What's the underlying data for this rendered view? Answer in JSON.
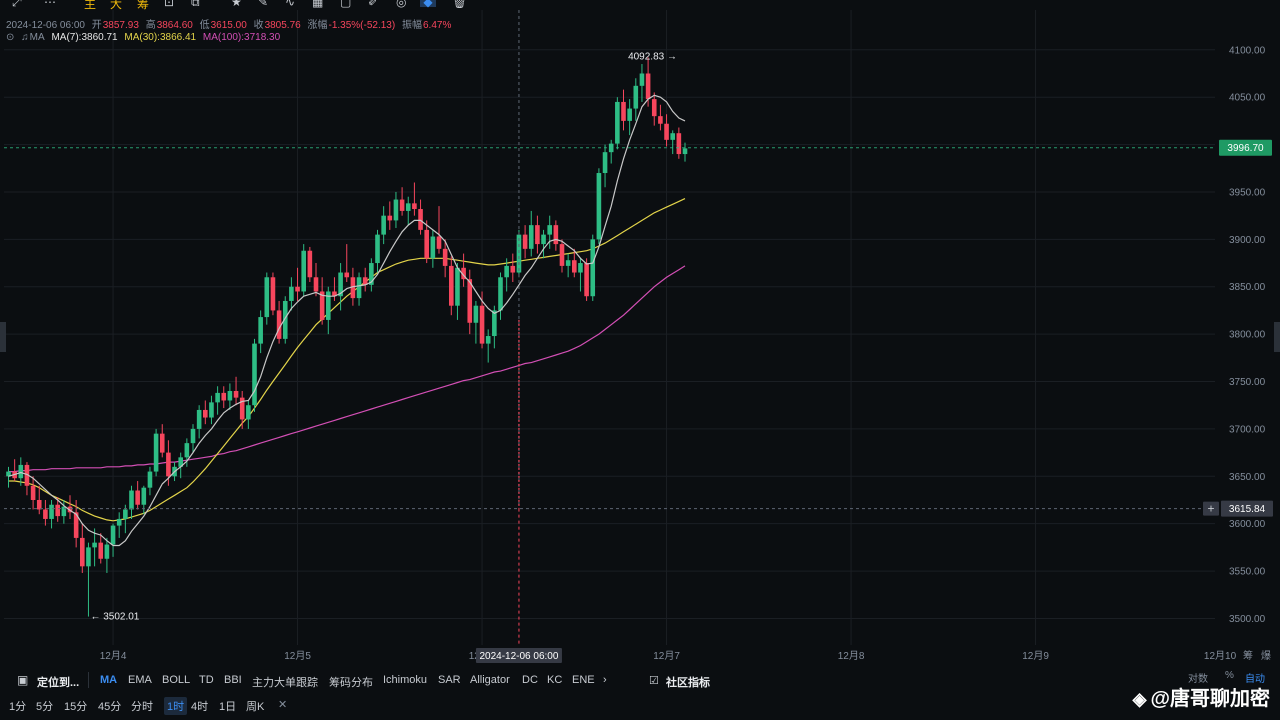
{
  "toolbar": {
    "items": [
      {
        "glyph": "⤢",
        "name": "expand-icon"
      },
      {
        "glyph": "⋯",
        "name": "more-icon"
      },
      {
        "glyph": "主",
        "name": "main-indicator-button"
      },
      {
        "glyph": "大",
        "name": "large-order-button"
      },
      {
        "glyph": "筹",
        "name": "chip-distribution-button"
      },
      {
        "glyph": "⊡",
        "name": "snapshot-icon"
      },
      {
        "glyph": "⧉",
        "name": "compare-icon"
      },
      {
        "glyph": "★",
        "name": "favorite-icon"
      },
      {
        "glyph": "✎",
        "name": "pencil-icon"
      },
      {
        "glyph": "∿",
        "name": "curve-icon"
      },
      {
        "glyph": "▦",
        "name": "candles-icon"
      },
      {
        "glyph": "▢",
        "name": "rectangle-icon"
      },
      {
        "glyph": "✐",
        "name": "annotate-icon"
      },
      {
        "glyph": "◎",
        "name": "magnet-icon"
      },
      {
        "glyph": "◆",
        "name": "select-tool-icon"
      },
      {
        "glyph": "🗑",
        "name": "trash-icon"
      }
    ]
  },
  "ohlc": {
    "date": "2024-12-06 06:00",
    "open_label": "开",
    "open": "3857.93",
    "high_label": "高",
    "high": "3864.60",
    "low_label": "低",
    "low": "3615.00",
    "close_label": "收",
    "close": "3805.76",
    "change_label": "涨幅",
    "change": "-1.35%(-52.13)",
    "amp_label": "振幅",
    "amp": "6.47%"
  },
  "ma_legend": {
    "label": "MA",
    "ma7": "MA(7):3860.71",
    "ma30": "MA(30):3866.41",
    "ma100": "MA(100):3718.30"
  },
  "colors": {
    "up": "#2ebd85",
    "down": "#f6465d",
    "ma7": "#c8c8c8",
    "ma30": "#e3d44a",
    "ma100": "#d34fb5",
    "grid": "#1b1f24",
    "price_tag": "#1f9a64"
  },
  "chart_data": {
    "type": "candlestick",
    "symbol_interval": "1时",
    "y_ticks": [
      "4100.00",
      "4050.00",
      "4000.00",
      "3950.00",
      "3900.00",
      "3850.00",
      "3800.00",
      "3750.00",
      "3700.00",
      "3650.00",
      "3600.00",
      "3550.00",
      "3500.00"
    ],
    "y_tick_values": [
      4100,
      4050,
      4000,
      3950,
      3900,
      3850,
      3800,
      3750,
      3700,
      3650,
      3600,
      3550,
      3500
    ],
    "ylim": [
      3472,
      4142
    ],
    "x_tick_labels": [
      "12月4",
      "12月5",
      "12月6",
      "12月7",
      "12月8",
      "12月9",
      "12月10"
    ],
    "x_tick_index": [
      17,
      47,
      77,
      107,
      137,
      167,
      197
    ],
    "current_price": "3996.70",
    "current_price_value": 3996.7,
    "crosshair_price": "3615.84",
    "crosshair_price_value": 3615.84,
    "crosshair_time": "2024-12-06 06:00",
    "crosshair_index": 83,
    "high_marker": "4092.83",
    "high_marker_index": 110,
    "high_marker_value": 4092.83,
    "low_marker": "3502.01",
    "low_marker_index": 13,
    "low_marker_value": 3502.01,
    "candles": [
      [
        3650,
        3660,
        3638,
        3655
      ],
      [
        3655,
        3668,
        3645,
        3648
      ],
      [
        3648,
        3670,
        3640,
        3662
      ],
      [
        3662,
        3665,
        3630,
        3640
      ],
      [
        3640,
        3650,
        3615,
        3625
      ],
      [
        3625,
        3640,
        3610,
        3615
      ],
      [
        3615,
        3625,
        3598,
        3605
      ],
      [
        3605,
        3625,
        3595,
        3620
      ],
      [
        3620,
        3628,
        3602,
        3608
      ],
      [
        3608,
        3625,
        3600,
        3618
      ],
      [
        3618,
        3630,
        3605,
        3612
      ],
      [
        3612,
        3625,
        3575,
        3585
      ],
      [
        3585,
        3600,
        3548,
        3555
      ],
      [
        3555,
        3580,
        3502,
        3575
      ],
      [
        3575,
        3595,
        3555,
        3580
      ],
      [
        3580,
        3590,
        3558,
        3563
      ],
      [
        3563,
        3585,
        3548,
        3578
      ],
      [
        3578,
        3600,
        3565,
        3598
      ],
      [
        3598,
        3612,
        3585,
        3605
      ],
      [
        3605,
        3620,
        3590,
        3615
      ],
      [
        3615,
        3640,
        3605,
        3635
      ],
      [
        3635,
        3645,
        3615,
        3620
      ],
      [
        3620,
        3640,
        3610,
        3638
      ],
      [
        3638,
        3660,
        3630,
        3655
      ],
      [
        3655,
        3700,
        3650,
        3695
      ],
      [
        3695,
        3705,
        3670,
        3675
      ],
      [
        3675,
        3688,
        3640,
        3650
      ],
      [
        3650,
        3665,
        3645,
        3660
      ],
      [
        3660,
        3675,
        3648,
        3670
      ],
      [
        3670,
        3690,
        3660,
        3685
      ],
      [
        3685,
        3705,
        3675,
        3700
      ],
      [
        3700,
        3725,
        3690,
        3720
      ],
      [
        3720,
        3730,
        3705,
        3712
      ],
      [
        3712,
        3735,
        3705,
        3728
      ],
      [
        3728,
        3745,
        3715,
        3738
      ],
      [
        3738,
        3745,
        3722,
        3730
      ],
      [
        3730,
        3748,
        3720,
        3740
      ],
      [
        3740,
        3755,
        3725,
        3733
      ],
      [
        3733,
        3740,
        3700,
        3710
      ],
      [
        3710,
        3730,
        3700,
        3725
      ],
      [
        3725,
        3795,
        3718,
        3790
      ],
      [
        3790,
        3825,
        3780,
        3818
      ],
      [
        3818,
        3865,
        3810,
        3860
      ],
      [
        3860,
        3865,
        3820,
        3825
      ],
      [
        3825,
        3835,
        3790,
        3795
      ],
      [
        3795,
        3840,
        3790,
        3835
      ],
      [
        3835,
        3860,
        3825,
        3850
      ],
      [
        3850,
        3870,
        3835,
        3845
      ],
      [
        3845,
        3895,
        3840,
        3888
      ],
      [
        3888,
        3892,
        3855,
        3860
      ],
      [
        3860,
        3875,
        3840,
        3845
      ],
      [
        3845,
        3860,
        3810,
        3815
      ],
      [
        3815,
        3850,
        3800,
        3845
      ],
      [
        3845,
        3860,
        3835,
        3840
      ],
      [
        3840,
        3875,
        3825,
        3865
      ],
      [
        3865,
        3895,
        3855,
        3860
      ],
      [
        3860,
        3870,
        3830,
        3838
      ],
      [
        3838,
        3865,
        3830,
        3860
      ],
      [
        3860,
        3870,
        3845,
        3852
      ],
      [
        3852,
        3880,
        3845,
        3875
      ],
      [
        3875,
        3910,
        3865,
        3905
      ],
      [
        3905,
        3935,
        3895,
        3925
      ],
      [
        3925,
        3940,
        3910,
        3920
      ],
      [
        3920,
        3950,
        3912,
        3942
      ],
      [
        3942,
        3955,
        3925,
        3930
      ],
      [
        3930,
        3945,
        3915,
        3938
      ],
      [
        3938,
        3960,
        3925,
        3932
      ],
      [
        3932,
        3942,
        3905,
        3910
      ],
      [
        3910,
        3920,
        3875,
        3880
      ],
      [
        3880,
        3910,
        3870,
        3903
      ],
      [
        3903,
        3935,
        3885,
        3890
      ],
      [
        3890,
        3900,
        3860,
        3872
      ],
      [
        3872,
        3882,
        3820,
        3830
      ],
      [
        3830,
        3875,
        3815,
        3870
      ],
      [
        3870,
        3885,
        3850,
        3858
      ],
      [
        3858,
        3868,
        3800,
        3812
      ],
      [
        3812,
        3835,
        3790,
        3830
      ],
      [
        3830,
        3845,
        3785,
        3790
      ],
      [
        3790,
        3805,
        3770,
        3798
      ],
      [
        3798,
        3830,
        3785,
        3825
      ],
      [
        3825,
        3865,
        3815,
        3860
      ],
      [
        3860,
        3880,
        3845,
        3872
      ],
      [
        3872,
        3885,
        3855,
        3865
      ],
      [
        3865,
        3910,
        3860,
        3905
      ],
      [
        3905,
        3915,
        3880,
        3890
      ],
      [
        3890,
        3930,
        3882,
        3915
      ],
      [
        3915,
        3925,
        3885,
        3895
      ],
      [
        3895,
        3910,
        3880,
        3905
      ],
      [
        3905,
        3925,
        3890,
        3915
      ],
      [
        3915,
        3920,
        3888,
        3895
      ],
      [
        3895,
        3900,
        3865,
        3872
      ],
      [
        3872,
        3885,
        3860,
        3878
      ],
      [
        3878,
        3890,
        3860,
        3865
      ],
      [
        3865,
        3880,
        3845,
        3875
      ],
      [
        3875,
        3880,
        3835,
        3840
      ],
      [
        3840,
        3905,
        3835,
        3900
      ],
      [
        3900,
        3975,
        3895,
        3970
      ],
      [
        3970,
        4000,
        3955,
        3992
      ],
      [
        3992,
        4005,
        3980,
        4001
      ],
      [
        4001,
        4050,
        3995,
        4045
      ],
      [
        4045,
        4058,
        4015,
        4025
      ],
      [
        4025,
        4048,
        4010,
        4038
      ],
      [
        4038,
        4070,
        4025,
        4062
      ],
      [
        4062,
        4085,
        4045,
        4075
      ],
      [
        4075,
        4092,
        4040,
        4048
      ],
      [
        4048,
        4055,
        4020,
        4030
      ],
      [
        4030,
        4042,
        4015,
        4022
      ],
      [
        4022,
        4032,
        3998,
        4005
      ],
      [
        4005,
        4015,
        3990,
        4012
      ],
      [
        4012,
        4018,
        3985,
        3990
      ],
      [
        3990,
        4002,
        3982,
        3996
      ]
    ],
    "ma7": [
      3650,
      3652,
      3654,
      3652,
      3648,
      3642,
      3636,
      3630,
      3625,
      3619,
      3614,
      3610,
      3600,
      3593,
      3590,
      3588,
      3582,
      3577,
      3577,
      3582,
      3592,
      3600,
      3608,
      3618,
      3630,
      3642,
      3648,
      3655,
      3660,
      3666,
      3675,
      3685,
      3693,
      3700,
      3709,
      3717,
      3722,
      3726,
      3729,
      3730,
      3740,
      3755,
      3775,
      3792,
      3806,
      3817,
      3827,
      3834,
      3840,
      3842,
      3844,
      3841,
      3840,
      3840,
      3843,
      3848,
      3850,
      3851,
      3852,
      3855,
      3863,
      3875,
      3887,
      3898,
      3908,
      3915,
      3920,
      3920,
      3915,
      3910,
      3905,
      3898,
      3884,
      3870,
      3862,
      3855,
      3845,
      3835,
      3827,
      3822,
      3825,
      3833,
      3842,
      3852,
      3862,
      3870,
      3880,
      3890,
      3898,
      3900,
      3898,
      3893,
      3888,
      3880,
      3874,
      3875,
      3892,
      3914,
      3935,
      3962,
      3985,
      4005,
      4022,
      4040,
      4048,
      4052,
      4050,
      4045,
      4035,
      4028,
      4025
    ],
    "ma30": [
      3645,
      3645,
      3644,
      3643,
      3641,
      3638,
      3634,
      3630,
      3627,
      3624,
      3621,
      3618,
      3614,
      3611,
      3608,
      3606,
      3604,
      3603,
      3604,
      3605,
      3607,
      3609,
      3611,
      3614,
      3618,
      3622,
      3626,
      3630,
      3634,
      3638,
      3644,
      3651,
      3658,
      3666,
      3674,
      3682,
      3690,
      3698,
      3706,
      3713,
      3722,
      3731,
      3741,
      3750,
      3759,
      3768,
      3777,
      3786,
      3794,
      3802,
      3810,
      3816,
      3822,
      3828,
      3834,
      3840,
      3845,
      3850,
      3855,
      3860,
      3865,
      3868,
      3871,
      3874,
      3876,
      3878,
      3879,
      3880,
      3880,
      3880,
      3880,
      3880,
      3879,
      3878,
      3877,
      3876,
      3875,
      3874,
      3873,
      3873,
      3874,
      3875,
      3876,
      3877,
      3878,
      3879,
      3880,
      3881,
      3882,
      3883,
      3884,
      3885,
      3886,
      3887,
      3888,
      3890,
      3893,
      3896,
      3900,
      3904,
      3908,
      3912,
      3916,
      3920,
      3924,
      3928,
      3931,
      3934,
      3937,
      3940,
      3943
    ],
    "ma100": [
      3655,
      3655,
      3656,
      3656,
      3657,
      3657,
      3657,
      3658,
      3658,
      3658,
      3658,
      3659,
      3659,
      3659,
      3659,
      3659,
      3660,
      3660,
      3660,
      3661,
      3661,
      3662,
      3662,
      3663,
      3663,
      3664,
      3665,
      3665,
      3666,
      3667,
      3668,
      3669,
      3670,
      3671,
      3673,
      3674,
      3676,
      3677,
      3679,
      3681,
      3683,
      3685,
      3687,
      3689,
      3691,
      3693,
      3695,
      3697,
      3699,
      3701,
      3703,
      3705,
      3707,
      3709,
      3711,
      3713,
      3715,
      3717,
      3719,
      3721,
      3723,
      3725,
      3727,
      3729,
      3731,
      3733,
      3735,
      3737,
      3739,
      3741,
      3743,
      3745,
      3747,
      3749,
      3751,
      3752,
      3754,
      3756,
      3758,
      3760,
      3761,
      3763,
      3765,
      3767,
      3769,
      3770,
      3772,
      3774,
      3776,
      3778,
      3780,
      3782,
      3785,
      3788,
      3792,
      3796,
      3800,
      3805,
      3810,
      3815,
      3820,
      3826,
      3832,
      3838,
      3844,
      3850,
      3855,
      3860,
      3864,
      3868,
      3872
    ]
  },
  "indicator_bar": {
    "locate": "定位到...",
    "indicators": [
      "MA",
      "EMA",
      "BOLL",
      "TD",
      "BBI",
      "主力大单跟踪",
      "筹码分布",
      "Ichimoku",
      "SAR",
      "Alligator",
      "DC",
      "KC",
      "ENE"
    ],
    "more": "›",
    "community": "社区指标",
    "right": [
      "对数",
      "%",
      "自动"
    ]
  },
  "timeframes": {
    "items": [
      "1分",
      "5分",
      "15分",
      "45分",
      "分时",
      "1时",
      "4时",
      "1日",
      "周K"
    ],
    "active": "1时",
    "close": "✕"
  },
  "watermark": {
    "logo": "◈",
    "text": "@唐哥聊加密"
  },
  "right_bottom": {
    "label1": "筹",
    "label2": "爆"
  }
}
